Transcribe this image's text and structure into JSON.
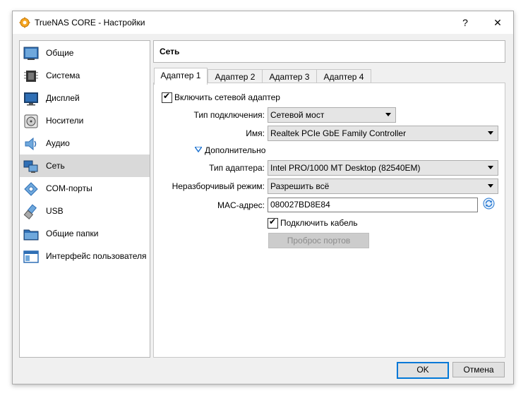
{
  "window": {
    "title": "TrueNAS CORE - Настройки",
    "help_label": "?",
    "close_label": "✕"
  },
  "sidebar": {
    "items": [
      {
        "label": "Общие",
        "icon": "general-icon"
      },
      {
        "label": "Система",
        "icon": "system-chip-icon"
      },
      {
        "label": "Дисплей",
        "icon": "display-monitor-icon"
      },
      {
        "label": "Носители",
        "icon": "storage-disk-icon"
      },
      {
        "label": "Аудио",
        "icon": "audio-speaker-icon"
      },
      {
        "label": "Сеть",
        "icon": "network-icon",
        "selected": true
      },
      {
        "label": "COM-порты",
        "icon": "serial-port-icon"
      },
      {
        "label": "USB",
        "icon": "usb-icon"
      },
      {
        "label": "Общие папки",
        "icon": "shared-folder-icon"
      },
      {
        "label": "Интерфейс пользователя",
        "icon": "user-interface-icon"
      }
    ]
  },
  "header": {
    "title": "Сеть"
  },
  "tabs": [
    {
      "label": "Адаптер 1",
      "active": true
    },
    {
      "label": "Адаптер 2"
    },
    {
      "label": "Адаптер 3"
    },
    {
      "label": "Адаптер 4"
    }
  ],
  "adapter": {
    "enable_label": "Включить сетевой адаптер",
    "enable_checked": true,
    "attached_label": "Тип подключения:",
    "attached_value": "Сетевой мост",
    "name_label": "Имя:",
    "name_value": "Realtek PCIe GbE Family Controller",
    "advanced_label": "Дополнительно",
    "type_label": "Тип адаптера:",
    "type_value": "Intel PRO/1000 MT Desktop (82540EM)",
    "promisc_label": "Неразборчивый режим:",
    "promisc_value": "Разрешить всё",
    "mac_label": "MAC-адрес:",
    "mac_value": "080027BD8E84",
    "cable_label": "Подключить кабель",
    "cable_checked": true,
    "port_forwarding_label": "Проброс портов"
  },
  "footer": {
    "ok_label": "OK",
    "cancel_label": "Отмена"
  },
  "colors": {
    "accent": "#0078d7",
    "selected_bg": "#d9d9d9",
    "icon_blue": "#2f6fb5"
  }
}
